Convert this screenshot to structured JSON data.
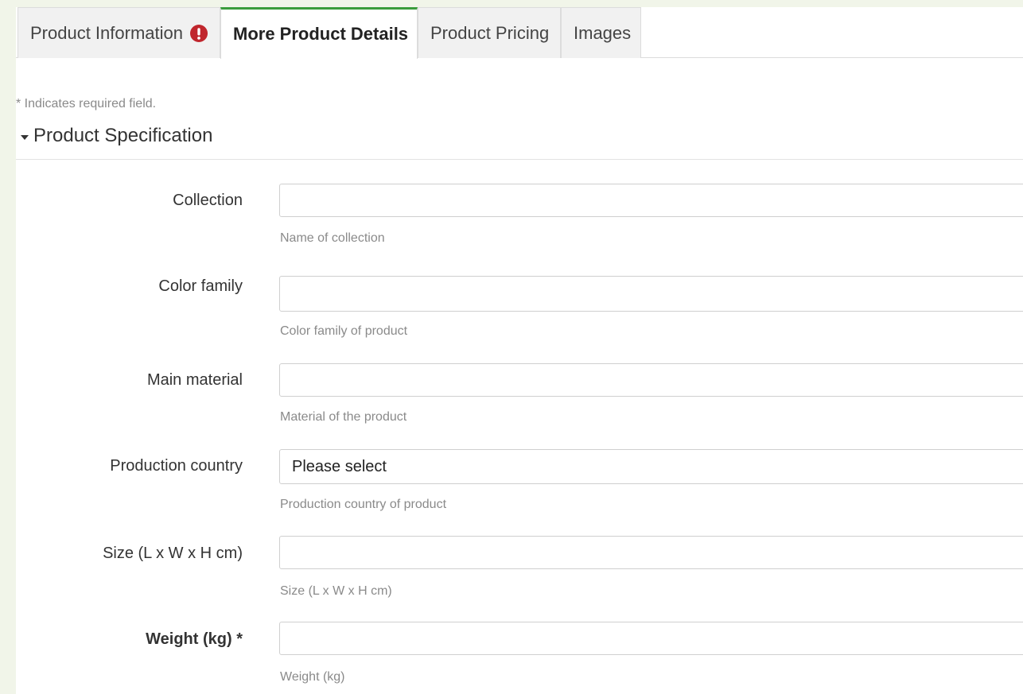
{
  "tabs": [
    {
      "label": "Product Information",
      "has_alert": true
    },
    {
      "label": "More Product Details",
      "active": true
    },
    {
      "label": "Product Pricing"
    },
    {
      "label": "Images"
    }
  ],
  "required_note": "* Indicates required field.",
  "section": {
    "title": "Product Specification"
  },
  "fields": {
    "collection": {
      "label": "Collection",
      "value": "",
      "help": "Name of collection"
    },
    "color_family": {
      "label": "Color family",
      "value": "",
      "help": "Color family of product"
    },
    "main_material": {
      "label": "Main material",
      "value": "",
      "help": "Material of the product"
    },
    "production_country": {
      "label": "Production country",
      "selected": "Please select",
      "help": "Production country of product"
    },
    "size": {
      "label": "Size (L x W x H cm)",
      "value": "",
      "help": "Size (L x W x H cm)"
    },
    "weight": {
      "label": "Weight (kg) *",
      "value": "",
      "help": "Weight (kg)"
    }
  },
  "colors": {
    "active_tab_accent": "#3a9c3c",
    "alert": "#c0262d",
    "background": "#f1f5e9"
  }
}
